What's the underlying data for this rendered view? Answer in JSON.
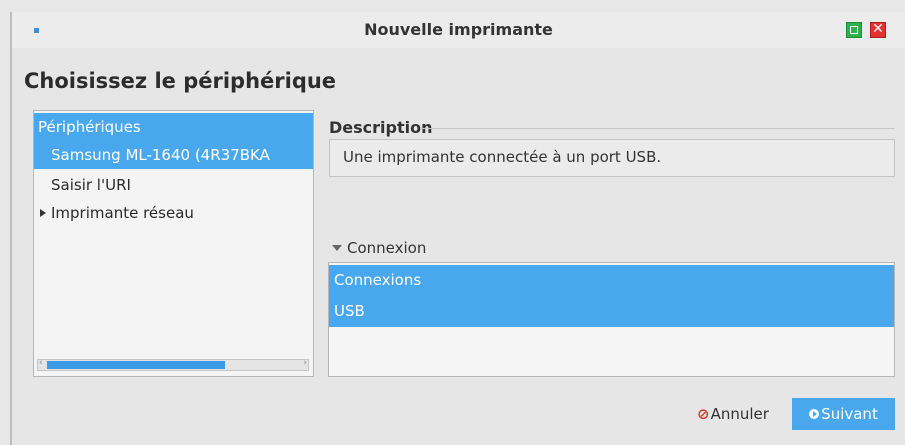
{
  "window": {
    "title": "Nouvelle imprimante",
    "close_glyph": "✕"
  },
  "page": {
    "heading": "Choisissez le périphérique"
  },
  "devices": {
    "header": "Périphériques",
    "items": [
      {
        "label": "Samsung ML-1640 (4R37BKA",
        "selected": true
      },
      {
        "label": "Saisir l'URI",
        "selected": false
      },
      {
        "label": "Imprimante réseau",
        "selected": false,
        "expandable": true
      }
    ]
  },
  "description": {
    "label": "Description",
    "text": "Une imprimante connectée à un port USB."
  },
  "connection": {
    "toggle_label": "Connexion",
    "header": "Connexions",
    "items": [
      "USB"
    ]
  },
  "buttons": {
    "cancel_label": "Annuler",
    "cancel_icon": "⊘",
    "next_label": "Suivant"
  },
  "colors": {
    "selection": "#49a8ed",
    "cancel_icon": "#d9352b",
    "maximize": "#2fb24a",
    "close": "#e3322f"
  },
  "icons": [
    "app-icon",
    "maximize-icon",
    "close-icon",
    "expand-arrow-icon",
    "collapse-arrow-icon",
    "cancel-icon",
    "next-arrow-icon"
  ]
}
